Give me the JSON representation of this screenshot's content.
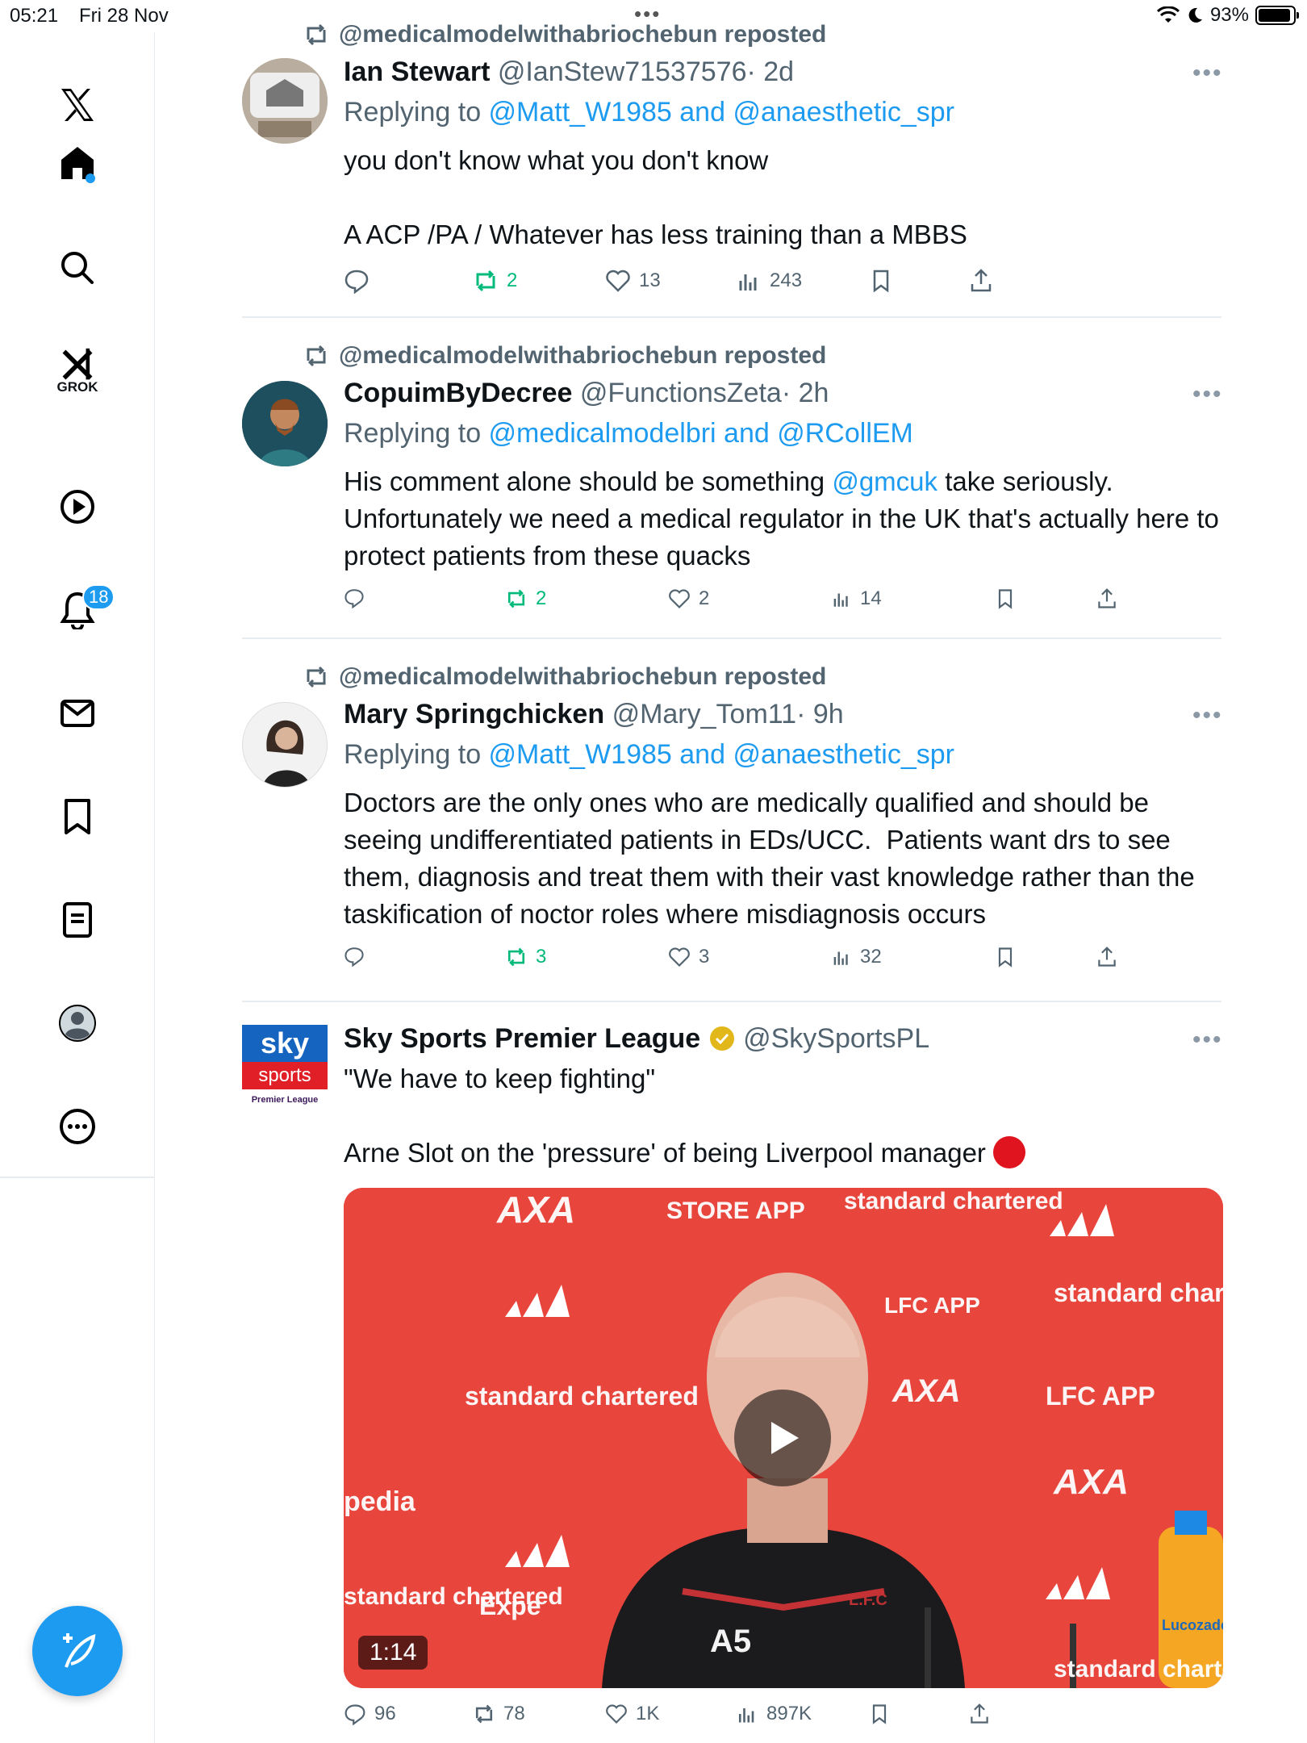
{
  "status_bar": {
    "time": "05:21",
    "date": "Fri 28 Nov",
    "battery": "93%",
    "battery_level": 0.93
  },
  "sidebar": {
    "items": [
      {
        "name": "x-logo"
      },
      {
        "name": "home"
      },
      {
        "name": "search"
      },
      {
        "name": "grok",
        "label": "GROK"
      },
      {
        "name": "video"
      },
      {
        "name": "notifications",
        "badge": "18"
      },
      {
        "name": "messages"
      },
      {
        "name": "bookmarks"
      },
      {
        "name": "lists"
      },
      {
        "name": "profile"
      },
      {
        "name": "more"
      }
    ]
  },
  "tweets": [
    {
      "repost": "@medicalmodelwithabriochebun reposted",
      "name": "Ian Stewart",
      "handle": "@IanStew71537576",
      "time": "· 2d",
      "replying_prefix": "Replying to ",
      "replying_to": "@Matt_W1985 and @anaesthetic_spr",
      "body_1": "you don't know what you don't know",
      "body_2": "A ACP /PA / Whatever has less training than a MBBS",
      "replies": "",
      "reposts": "2",
      "likes": "13",
      "views": "243"
    },
    {
      "repost": "@medicalmodelwithabriochebun reposted",
      "name": "CopuimByDecree",
      "handle": "@FunctionsZeta",
      "time": "· 2h",
      "replying_prefix": "Replying to ",
      "replying_to": "@medicalmodelbri and @RCollEM",
      "body_pre": "His comment alone should be something ",
      "body_mention": "@gmcuk",
      "body_post": " take seriously. Unfortunately we need a medical regulator in the UK that's actually here to protect patients from these quacks",
      "replies": "",
      "reposts": "2",
      "likes": "2",
      "views": "14"
    },
    {
      "repost": "@medicalmodelwithabriochebun reposted",
      "name": "Mary Springchicken",
      "handle": "@Mary_Tom11",
      "time": "· 9h",
      "replying_prefix": "Replying to ",
      "replying_to": "@Matt_W1985 and @anaesthetic_spr",
      "body": "Doctors are the only ones who are medically qualified and should be seeing undifferentiated patients in EDs/UCC.  Patients want drs to see them, diagnosis and treat them with their vast knowledge rather than the taskification of noctor roles where misdiagnosis occurs",
      "replies": "",
      "reposts": "3",
      "likes": "3",
      "views": "32"
    },
    {
      "name": "Sky Sports Premier League",
      "handle": "@SkySportsPL",
      "avatar_text_1": "sky",
      "avatar_text_2": "sports",
      "avatar_text_3": "Premier League",
      "body_1": "\"We have to keep fighting\"",
      "body_2": "Arne Slot on the 'pressure' of being Liverpool manager",
      "video_duration": "1:14",
      "media_texts": [
        "AXA",
        "standard chartered",
        "LFC APP",
        "STORE APP",
        "pedia",
        "Expe",
        "A5",
        "L.F.C",
        "Lucozade"
      ],
      "replies": "96",
      "reposts": "78",
      "likes": "1K",
      "views": "897K"
    }
  ],
  "colors": {
    "accent": "#1d9bf0",
    "repost_green": "#00ba7c",
    "muted": "#536471",
    "media_red": "#e8453c"
  }
}
